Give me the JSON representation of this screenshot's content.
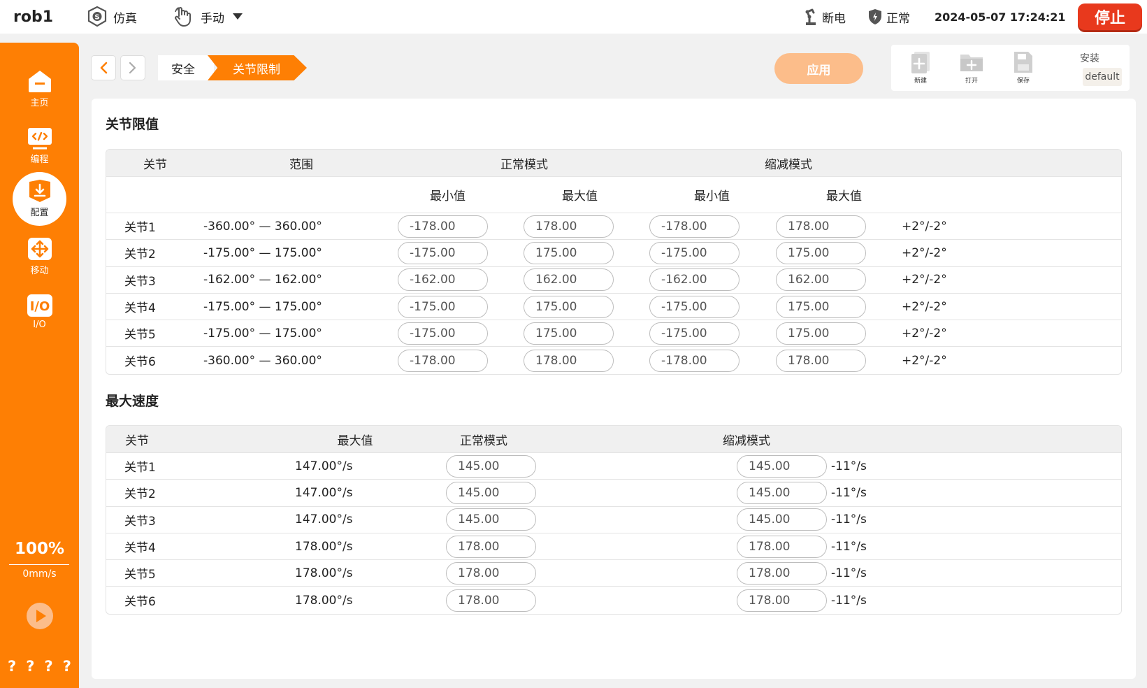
{
  "topbar": {
    "robot_name": "rob1",
    "sim_label": "仿真",
    "mode_label": "手动",
    "power_label": "断电",
    "safety_label": "正常",
    "datetime": "2024-05-07 17:24:21",
    "stop_label": "停止"
  },
  "sidebar": {
    "items": [
      {
        "label": "主页",
        "icon": "home-icon"
      },
      {
        "label": "编程",
        "icon": "code-icon"
      },
      {
        "label": "配置",
        "icon": "config-icon"
      },
      {
        "label": "移动",
        "icon": "move-icon"
      },
      {
        "label": "I/O",
        "icon": "io-icon"
      }
    ],
    "active": "配置",
    "speed_percent": "100%",
    "speed_mm": "0mm/s",
    "help_marks": [
      "?",
      "?",
      "?",
      "?"
    ]
  },
  "breadcrumb": {
    "items": [
      "安全",
      "关节限制"
    ]
  },
  "toolbar": {
    "apply_label": "应用",
    "new_label": "新建",
    "open_label": "打开",
    "save_label": "保存",
    "install_label": "安装",
    "install_value": "default"
  },
  "joint_limits": {
    "title": "关节限值",
    "headers": {
      "joint": "关节",
      "range": "范围",
      "normal": "正常模式",
      "reduced": "缩减模式",
      "min": "最小值",
      "max": "最大值"
    },
    "rows": [
      {
        "joint": "关节1",
        "range": "-360.00° — 360.00°",
        "n_min": "-178.00",
        "n_max": "178.00",
        "r_min": "-178.00",
        "r_max": "178.00",
        "tol": "+2°/-2°"
      },
      {
        "joint": "关节2",
        "range": "-175.00° — 175.00°",
        "n_min": "-175.00",
        "n_max": "175.00",
        "r_min": "-175.00",
        "r_max": "175.00",
        "tol": "+2°/-2°"
      },
      {
        "joint": "关节3",
        "range": "-162.00° — 162.00°",
        "n_min": "-162.00",
        "n_max": "162.00",
        "r_min": "-162.00",
        "r_max": "162.00",
        "tol": "+2°/-2°"
      },
      {
        "joint": "关节4",
        "range": "-175.00° — 175.00°",
        "n_min": "-175.00",
        "n_max": "175.00",
        "r_min": "-175.00",
        "r_max": "175.00",
        "tol": "+2°/-2°"
      },
      {
        "joint": "关节5",
        "range": "-175.00° — 175.00°",
        "n_min": "-175.00",
        "n_max": "175.00",
        "r_min": "-175.00",
        "r_max": "175.00",
        "tol": "+2°/-2°"
      },
      {
        "joint": "关节6",
        "range": "-360.00° — 360.00°",
        "n_min": "-178.00",
        "n_max": "178.00",
        "r_min": "-178.00",
        "r_max": "178.00",
        "tol": "+2°/-2°"
      }
    ]
  },
  "max_speed": {
    "title": "最大速度",
    "headers": {
      "joint": "关节",
      "max": "最大值",
      "normal": "正常模式",
      "reduced": "缩减模式"
    },
    "rows": [
      {
        "joint": "关节1",
        "max": "147.00°/s",
        "normal": "145.00",
        "reduced": "145.00",
        "diff": "-11°/s"
      },
      {
        "joint": "关节2",
        "max": "147.00°/s",
        "normal": "145.00",
        "reduced": "145.00",
        "diff": "-11°/s"
      },
      {
        "joint": "关节3",
        "max": "147.00°/s",
        "normal": "145.00",
        "reduced": "145.00",
        "diff": "-11°/s"
      },
      {
        "joint": "关节4",
        "max": "178.00°/s",
        "normal": "178.00",
        "reduced": "178.00",
        "diff": "-11°/s"
      },
      {
        "joint": "关节5",
        "max": "178.00°/s",
        "normal": "178.00",
        "reduced": "178.00",
        "diff": "-11°/s"
      },
      {
        "joint": "关节6",
        "max": "178.00°/s",
        "normal": "178.00",
        "reduced": "178.00",
        "diff": "-11°/s"
      }
    ]
  },
  "colors": {
    "accent": "#fe7f04",
    "stop": "#e8391d",
    "apply": "#fcbd8a"
  }
}
